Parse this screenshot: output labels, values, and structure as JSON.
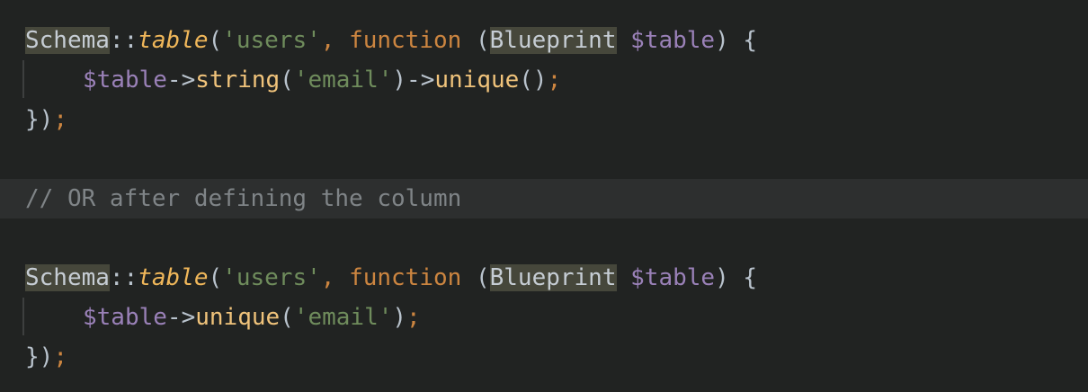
{
  "editor": {
    "block1": {
      "line1": {
        "class": "Schema",
        "op": "::",
        "method": "table",
        "open_paren": "(",
        "string": "'users'",
        "comma": ",",
        "keyword": "function",
        "open_paren2": "(",
        "type": "Blueprint",
        "var": "$table",
        "close": ") {"
      },
      "line2": {
        "var": "$table",
        "arrow": "->",
        "method1": "string",
        "open_paren": "(",
        "string": "'email'",
        "close_arrow": ")->",
        "method2": "unique",
        "parens": "()",
        "semi": ";"
      },
      "line3": {
        "close": "})",
        "semi": ";"
      }
    },
    "comment": "// OR after defining the column",
    "block2": {
      "line1": {
        "class": "Schema",
        "op": "::",
        "method": "table",
        "open_paren": "(",
        "string": "'users'",
        "comma": ",",
        "keyword": "function",
        "open_paren2": "(",
        "type": "Blueprint",
        "var": "$table",
        "close": ") {"
      },
      "line2": {
        "var": "$table",
        "arrow": "->",
        "method": "unique",
        "open_paren": "(",
        "string": "'email'",
        "close_paren": ")",
        "semi": ";"
      },
      "line3": {
        "close": "})",
        "semi": ";"
      }
    }
  },
  "colors": {
    "background": "#212322",
    "current_line": "#2d2f2f",
    "class_highlight": "#46473b",
    "keyword": "#cc8540",
    "string": "#6f8c5c",
    "variable": "#9a81b8",
    "method": "#f0c37b",
    "comment": "#7f8487"
  }
}
